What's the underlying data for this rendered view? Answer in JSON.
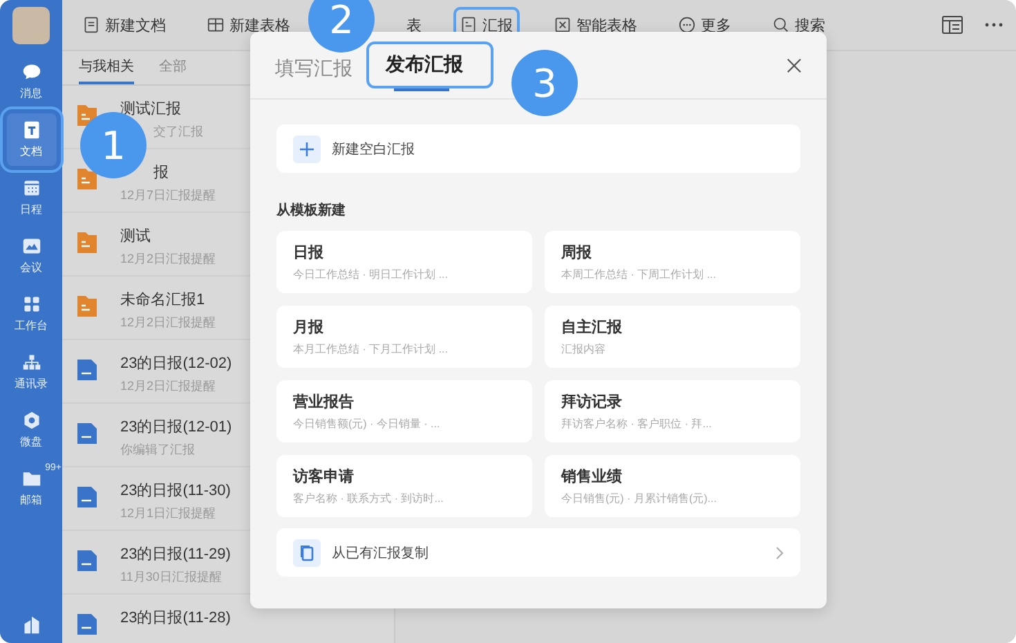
{
  "sidebar": {
    "items": [
      {
        "label": "消息",
        "selected": false,
        "highlighted": false
      },
      {
        "label": "文档",
        "selected": true,
        "highlighted": true
      },
      {
        "label": "日程",
        "selected": false,
        "highlighted": false
      },
      {
        "label": "会议",
        "selected": false,
        "highlighted": false
      },
      {
        "label": "工作台",
        "selected": false,
        "highlighted": false
      },
      {
        "label": "通讯录",
        "selected": false,
        "highlighted": false
      },
      {
        "label": "微盘",
        "selected": false,
        "highlighted": false
      },
      {
        "label": "邮箱",
        "selected": false,
        "highlighted": false,
        "badge": "99+"
      }
    ]
  },
  "toolbar": {
    "items": [
      {
        "label": "新建文档",
        "highlighted": false
      },
      {
        "label": "新建表格",
        "highlighted": false
      },
      {
        "label": "表",
        "highlighted": false
      },
      {
        "label": "汇报",
        "highlighted": true
      },
      {
        "label": "智能表格",
        "highlighted": false
      },
      {
        "label": "更多",
        "highlighted": false
      },
      {
        "label": "搜索",
        "highlighted": false
      }
    ]
  },
  "list": {
    "tabs": [
      {
        "label": "与我相关",
        "selected": true
      },
      {
        "label": "全部",
        "selected": false
      }
    ],
    "items": [
      {
        "kind": "report",
        "title": "测试汇报",
        "subtitle": "交了汇报"
      },
      {
        "kind": "report",
        "title": "报",
        "subtitle": "12月7日汇报提醒"
      },
      {
        "kind": "report",
        "title": "测试",
        "subtitle": "12月2日汇报提醒"
      },
      {
        "kind": "report",
        "title": "未命名汇报1",
        "subtitle": "12月2日汇报提醒"
      },
      {
        "kind": "doc",
        "title": "23的日报(12-02)",
        "subtitle": "12月2日汇报提醒"
      },
      {
        "kind": "doc",
        "title": "23的日报(12-01)",
        "subtitle": "你编辑了汇报"
      },
      {
        "kind": "doc",
        "title": "23的日报(11-30)",
        "subtitle": "12月1日汇报提醒"
      },
      {
        "kind": "doc",
        "title": "23的日报(11-29)",
        "subtitle": "11月30日汇报提醒"
      },
      {
        "kind": "doc",
        "title": "23的日报(11-28)"
      }
    ]
  },
  "dialog": {
    "tabs": [
      {
        "label": "填写汇报",
        "selected": false,
        "highlighted": false
      },
      {
        "label": "发布汇报",
        "selected": true,
        "highlighted": true
      }
    ],
    "new_blank": "新建空白汇报",
    "section_title": "从模板新建",
    "templates": [
      {
        "title": "日报",
        "description": "今日工作总结 · 明日工作计划 ..."
      },
      {
        "title": "周报",
        "description": "本周工作总结 · 下周工作计划 ..."
      },
      {
        "title": "月报",
        "description": "本月工作总结 · 下月工作计划 ..."
      },
      {
        "title": "自主汇报",
        "description": "汇报内容"
      },
      {
        "title": "营业报告",
        "description": "今日销售额(元) · 今日销量 · ..."
      },
      {
        "title": "拜访记录",
        "description": "拜访客户名称 · 客户职位 · 拜..."
      },
      {
        "title": "访客申请",
        "description": "客户名称 · 联系方式 · 到访时..."
      },
      {
        "title": "销售业绩",
        "description": "今日销售(元) · 月累计销售(元)..."
      }
    ],
    "copy_existing": "从已有汇报复制"
  },
  "callouts": [
    "1",
    "2",
    "3"
  ]
}
